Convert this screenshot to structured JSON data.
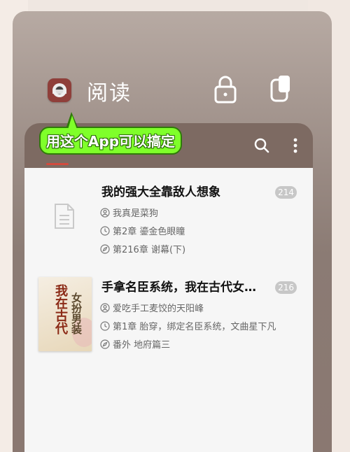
{
  "header": {
    "title": "阅读",
    "icons": [
      "app-icon",
      "lock-icon",
      "copy-icon"
    ]
  },
  "bubble": {
    "text": "用这个App可以搞定"
  },
  "toolbar": {
    "icons": [
      "search-icon",
      "more-vert-icon"
    ]
  },
  "books": [
    {
      "title": "我的强大全靠敌人想象",
      "author": "我真是菜狗",
      "current_chapter": "第2章 鎏金色眼瞳",
      "latest_chapter": "第216章 谢幕(下)",
      "count": "214",
      "cover": "placeholder-document-icon"
    },
    {
      "title": "手拿名臣系统，我在古代女…",
      "author": "爱吃手工麦饺的天阳峰",
      "current_chapter": "第1章 胎穿，绑定名臣系统，文曲星下凡",
      "latest_chapter": "番外 地府篇三",
      "count": "216",
      "cover_text_1": "我在古代",
      "cover_text_2": "女扮男装"
    }
  ],
  "colors": {
    "accent_tab": "#d24b3e",
    "bubble_fill": "#7fff2a",
    "bubble_border": "#2f7a09",
    "app_bar": "#7d6a62"
  }
}
